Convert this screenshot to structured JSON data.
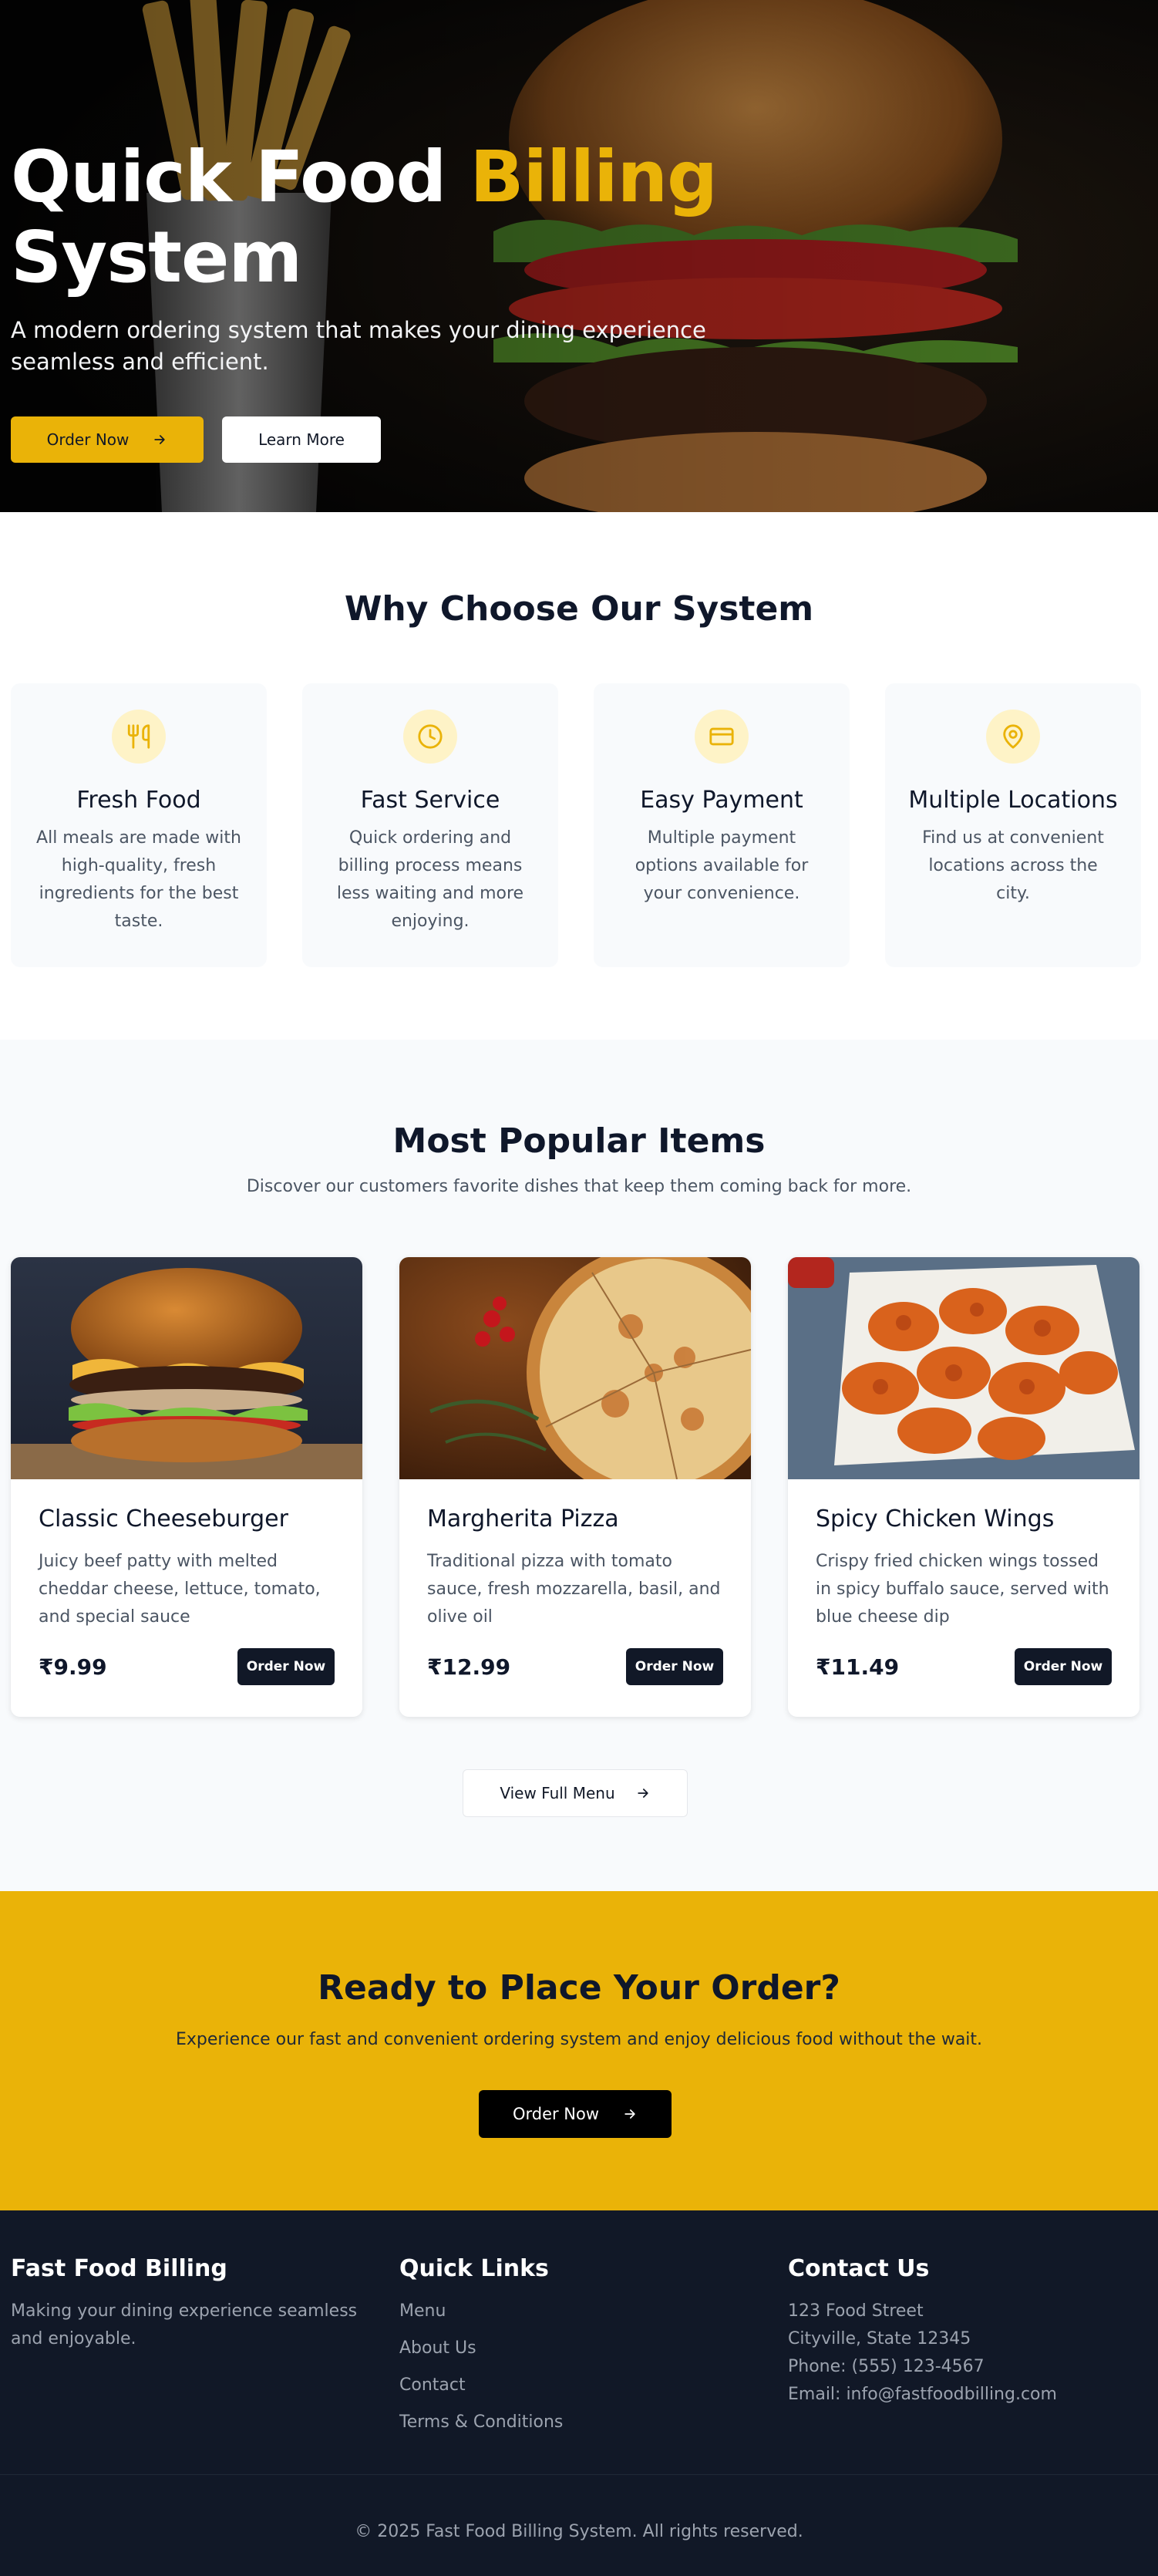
{
  "hero": {
    "title_part1": "Quick Food ",
    "title_accent": "Billing",
    "title_part2": " System",
    "subtitle": "A modern ordering system that makes your dining experience seamless and efficient.",
    "order_button": "Order Now",
    "learn_button": "Learn More"
  },
  "features": {
    "title": "Why Choose Our System",
    "items": [
      {
        "icon": "utensils-icon",
        "title": "Fresh Food",
        "desc": "All meals are made with high-quality, fresh ingredients for the best taste."
      },
      {
        "icon": "clock-icon",
        "title": "Fast Service",
        "desc": "Quick ordering and billing process means less waiting and more enjoying."
      },
      {
        "icon": "credit-card-icon",
        "title": "Easy Payment",
        "desc": "Multiple payment options available for your convenience."
      },
      {
        "icon": "map-pin-icon",
        "title": "Multiple Locations",
        "desc": "Find us at convenient locations across the city."
      }
    ]
  },
  "popular": {
    "title": "Most Popular Items",
    "subtitle": "Discover our customers favorite dishes that keep them coming back for more.",
    "items": [
      {
        "name": "Classic Cheeseburger",
        "desc": "Juicy beef patty with melted cheddar cheese, lettuce, tomato, and special sauce",
        "price": "₹9.99",
        "button": "Order Now"
      },
      {
        "name": "Margherita Pizza",
        "desc": "Traditional pizza with tomato sauce, fresh mozzarella, basil, and olive oil",
        "price": "₹12.99",
        "button": "Order Now"
      },
      {
        "name": "Spicy Chicken Wings",
        "desc": "Crispy fried chicken wings tossed in spicy buffalo sauce, served with blue cheese dip",
        "price": "₹11.49",
        "button": "Order Now"
      }
    ],
    "view_menu_button": "View Full Menu"
  },
  "cta": {
    "title": "Ready to Place Your Order?",
    "text": "Experience our fast and convenient ordering system and enjoy delicious food without the wait.",
    "button": "Order Now"
  },
  "footer": {
    "brand": "Fast Food Billing",
    "tagline": "Making your dining experience seamless and enjoyable.",
    "links_heading": "Quick Links",
    "links": [
      "Menu",
      "About Us",
      "Contact",
      "Terms & Conditions"
    ],
    "contact_heading": "Contact Us",
    "contact": [
      "123 Food Street",
      "Cityville, State 12345",
      "Phone: (555) 123-4567",
      "Email: info@fastfoodbilling.com"
    ],
    "copyright": "© 2025 Fast Food Billing System. All rights reserved."
  },
  "colors": {
    "accent": "#eab308",
    "dark": "#111827",
    "icon_bg": "#fef3c7"
  }
}
